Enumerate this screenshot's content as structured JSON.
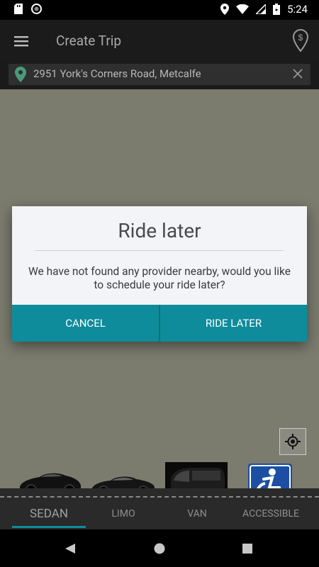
{
  "status_bar": {
    "time": "5:24"
  },
  "toolbar": {
    "title": "Create Trip"
  },
  "address": {
    "text": "2951 York's Corners Road, Metcalfe"
  },
  "dialog": {
    "title": "Ride later",
    "message": "We have not found any provider nearby, would you like to schedule your ride later?",
    "cancel_label": "CANCEL",
    "ride_later_label": "RIDE LATER"
  },
  "vehicles": [
    {
      "label": "SEDAN",
      "selected": true
    },
    {
      "label": "LIMO",
      "selected": false
    },
    {
      "label": "VAN",
      "selected": false
    },
    {
      "label": "ACCESSIBLE",
      "selected": false
    }
  ],
  "colors": {
    "accent": "#0f8c9b",
    "map_overlay": "#7b7b6e"
  }
}
